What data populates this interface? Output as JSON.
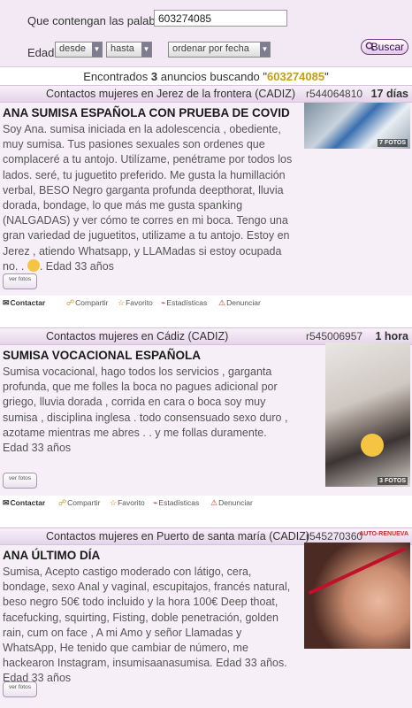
{
  "search": {
    "words_label": "Que contengan las palabras",
    "words_value": "603274085",
    "age_label": "Edad",
    "from_value": "desde",
    "to_value": "hasta",
    "order_value": "ordenar por fecha",
    "button_label": "Buscar"
  },
  "results": {
    "prefix": "Encontrados",
    "count": "3",
    "middle": "anuncios buscando \"",
    "query": "603274085",
    "suffix": "\""
  },
  "ads": [
    {
      "location": "Contactos mujeres en Jerez de la frontera (CADIZ)",
      "ref": "r544064810",
      "age": "17 días",
      "title": "ANA SUMISA ESPAÑOLA CON PRUEBA DE COVID",
      "text_lines": [
        "Soy Ana. sumisa iniciada en la adolescencia , obediente,",
        "muy sumisa. Tus pasiones sexuales son ordenes que",
        "complaceré a tu antojo. Utilízame, penétrame por todos los",
        "lados. seré, tu juguetito preferido. Me gusta la humillación",
        "verbal, BESO Negro garganta profunda deepthorat, lluvia",
        "dorada, bondage, lo que más me gusta spanking",
        "(NALGADAS) y ver cómo te corres en mi boca. Tengo una",
        "gran variedad de juguetitos, utilizame a tu antojo. Estoy en",
        "Jerez , atiendo Whatsapp, y LLAMadas si estoy ocupada",
        "no. .",
        "Edad 33 años"
      ],
      "photo_count": "7 FOTOS",
      "ver_fotos": "ver fotos",
      "actions": {
        "contact": "Contactar",
        "share": "Compartir",
        "fav": "Favorito",
        "stats": "Estadísticas",
        "report": "Denunciar"
      }
    },
    {
      "location": "Contactos mujeres en Cádiz (CADIZ)",
      "ref": "r545006957",
      "age": "1 hora",
      "title": "SUMISA VOCACIONAL ESPAÑOLA",
      "text_lines": [
        "Sumisa vocacional, hago todos los servicios , garganta",
        "profunda, que me folles la boca no pagues adicional por",
        "griego, lluvia dorada , corrida en cara o boca soy muy",
        "sumisa , disciplina inglesa . todo consensuado sexo duro ,",
        "azotame mientras me abres . . y me follas duramente.",
        "Edad 33 años"
      ],
      "photo_count": "3 FOTOS",
      "ver_fotos": "ver fotos",
      "actions": {
        "contact": "Contactar",
        "share": "Compartir",
        "fav": "Favorito",
        "stats": "Estadísticas",
        "report": "Denunciar"
      }
    },
    {
      "location": "Contactos mujeres en Puerto de santa maría (CADIZ)",
      "ref": "r545270360",
      "age": "AUTO-RENUEVA",
      "title": "ANA ÚLTIMO DÍA",
      "text_lines": [
        "Sumisa, Acepto castigo moderado con látigo, cera,",
        "bondage, sexo Anal y vaginal, escupitajos, francés natural,",
        "beso negro 50€ todo incluido y la hora 100€ Deep thoat,",
        "facefucking, squirting, Fisting, doble penetración, golden",
        "rain, cum on face , A mi Amo y señor Llamadas y",
        "WhatsApp, He tenido que cambiar de número, me",
        "hackearon Instagram, insumisaanasumisa. Edad 33 años.",
        "Edad 33 años"
      ],
      "ver_fotos": "ver fotos"
    }
  ]
}
